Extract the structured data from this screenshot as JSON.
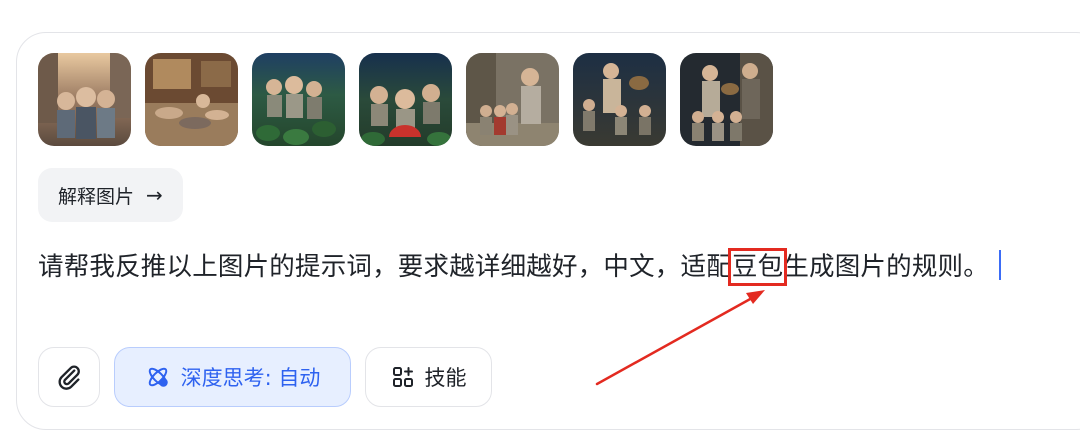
{
  "thumbnails": [
    {
      "name": "image-1",
      "icon": "photo-children-street-sunset"
    },
    {
      "name": "image-2",
      "icon": "photo-children-sleeping-room"
    },
    {
      "name": "image-3",
      "icon": "photo-children-watermelon-field"
    },
    {
      "name": "image-4",
      "icon": "photo-children-eating-watermelon"
    },
    {
      "name": "image-5",
      "icon": "photo-woman-with-children"
    },
    {
      "name": "image-6",
      "icon": "photo-woman-basket-children"
    },
    {
      "name": "image-7",
      "icon": "photo-adults-children-doorway"
    }
  ],
  "explain_chip": {
    "label": "解释图片",
    "arrow": "→"
  },
  "prompt": {
    "before": "请帮我反推以上图片的提示词，要求越详细越好，中文，适配",
    "highlight": "豆包",
    "after": "生成图片的规则。"
  },
  "toolbar": {
    "attach_icon": "paperclip-icon",
    "deep_think_label": "深度思考: 自动",
    "deep_think_icon": "atom-icon",
    "skills_label": "技能",
    "skills_icon": "apps-grid-icon"
  },
  "colors": {
    "accent": "#2e62f0",
    "accent_bg": "#e7efff",
    "annotation_red": "#e32a20",
    "text": "#1f2329"
  }
}
